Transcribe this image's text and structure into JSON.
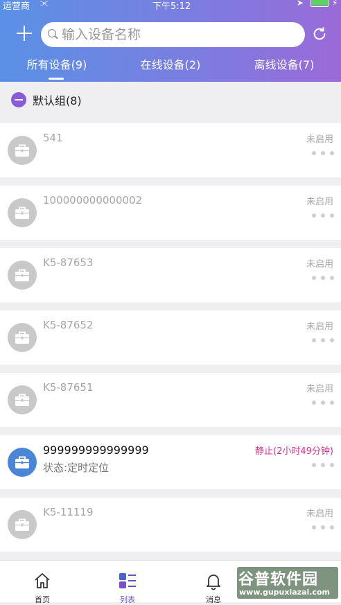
{
  "status_bar": {
    "carrier": "运营商",
    "time": "下午5:12"
  },
  "header": {
    "search_placeholder": "输入设备名称",
    "tabs": [
      {
        "label": "所有设备(9)",
        "active": true
      },
      {
        "label": "在线设备(2)",
        "active": false
      },
      {
        "label": "离线设备(7)",
        "active": false
      }
    ]
  },
  "group": {
    "label": "默认组(8)"
  },
  "devices": [
    {
      "name": "541",
      "status": "未启用",
      "sub": ""
    },
    {
      "name": "100000000000002",
      "status": "未启用",
      "sub": ""
    },
    {
      "name": "K5-87653",
      "status": "未启用",
      "sub": ""
    },
    {
      "name": "K5-87652",
      "status": "未启用",
      "sub": ""
    },
    {
      "name": "K5-87651",
      "status": "未启用",
      "sub": ""
    },
    {
      "name": "999999999999999",
      "status": "静止(2小时49分钟)",
      "sub": "状态:定时定位"
    },
    {
      "name": "K5-11119",
      "status": "未启用",
      "sub": ""
    }
  ],
  "tabbar": {
    "items": [
      {
        "label": "首页",
        "icon": "home-icon"
      },
      {
        "label": "列表",
        "icon": "list-icon",
        "active": true
      },
      {
        "label": "消息",
        "icon": "bell-icon"
      }
    ]
  },
  "watermark": {
    "title": "谷普软件园",
    "url": "www.gupuxiazai.com"
  },
  "colors": {
    "accent": "#7a7ee0",
    "status_pink": "#e0308c",
    "online_icon": "#4a86d8",
    "offline_icon": "#c9c9c9"
  }
}
